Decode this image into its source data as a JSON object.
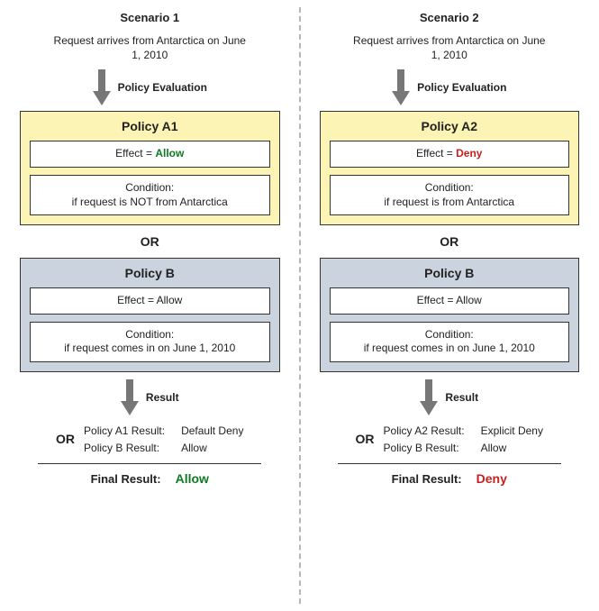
{
  "scenario1": {
    "title": "Scenario 1",
    "request": "Request arrives from Antarctica on June 1, 2010",
    "arrow1_label": "Policy Evaluation",
    "policyA": {
      "title": "Policy A1",
      "effect_prefix": "Effect = ",
      "effect_value": "Allow",
      "condition": "Condition:\nif request is NOT from Antarctica"
    },
    "or": "OR",
    "policyB": {
      "title": "Policy B",
      "effect_prefix": "Effect = ",
      "effect_value": "Allow",
      "condition": "Condition:\nif request comes in on June 1, 2010"
    },
    "arrow2_label": "Result",
    "results": {
      "or": "OR",
      "a_label": "Policy A1 Result:",
      "a_value": "Default Deny",
      "b_label": "Policy B Result:",
      "b_value": "Allow"
    },
    "final_label": "Final Result:",
    "final_value": "Allow"
  },
  "scenario2": {
    "title": "Scenario 2",
    "request": "Request arrives from Antarctica on June 1, 2010",
    "arrow1_label": "Policy Evaluation",
    "policyA": {
      "title": "Policy A2",
      "effect_prefix": "Effect = ",
      "effect_value": "Deny",
      "condition": "Condition:\nif request is from Antarctica"
    },
    "or": "OR",
    "policyB": {
      "title": "Policy B",
      "effect_prefix": "Effect = ",
      "effect_value": "Allow",
      "condition": "Condition:\nif request comes in on June 1, 2010"
    },
    "arrow2_label": "Result",
    "results": {
      "or": "OR",
      "a_label": "Policy A2 Result:",
      "a_value": "Explicit Deny",
      "b_label": "Policy B Result:",
      "b_value": "Allow"
    },
    "final_label": "Final Result:",
    "final_value": "Deny"
  }
}
